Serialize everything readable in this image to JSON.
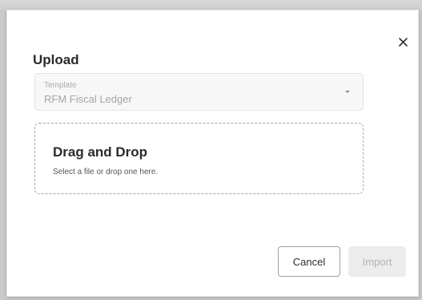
{
  "dialog": {
    "title": "Upload",
    "close_icon": "close-icon",
    "template_select": {
      "label": "Template",
      "value": "RFM Fiscal Ledger",
      "icon": "chevron-down-icon"
    },
    "dropzone": {
      "title": "Drag and Drop",
      "subtitle": "Select a file or drop one here."
    },
    "buttons": {
      "cancel_label": "Cancel",
      "import_label": "Import"
    }
  },
  "colors": {
    "backdrop": "#c9c9c9",
    "dialog_bg": "#ffffff",
    "disabled_button_bg": "#ececec"
  }
}
